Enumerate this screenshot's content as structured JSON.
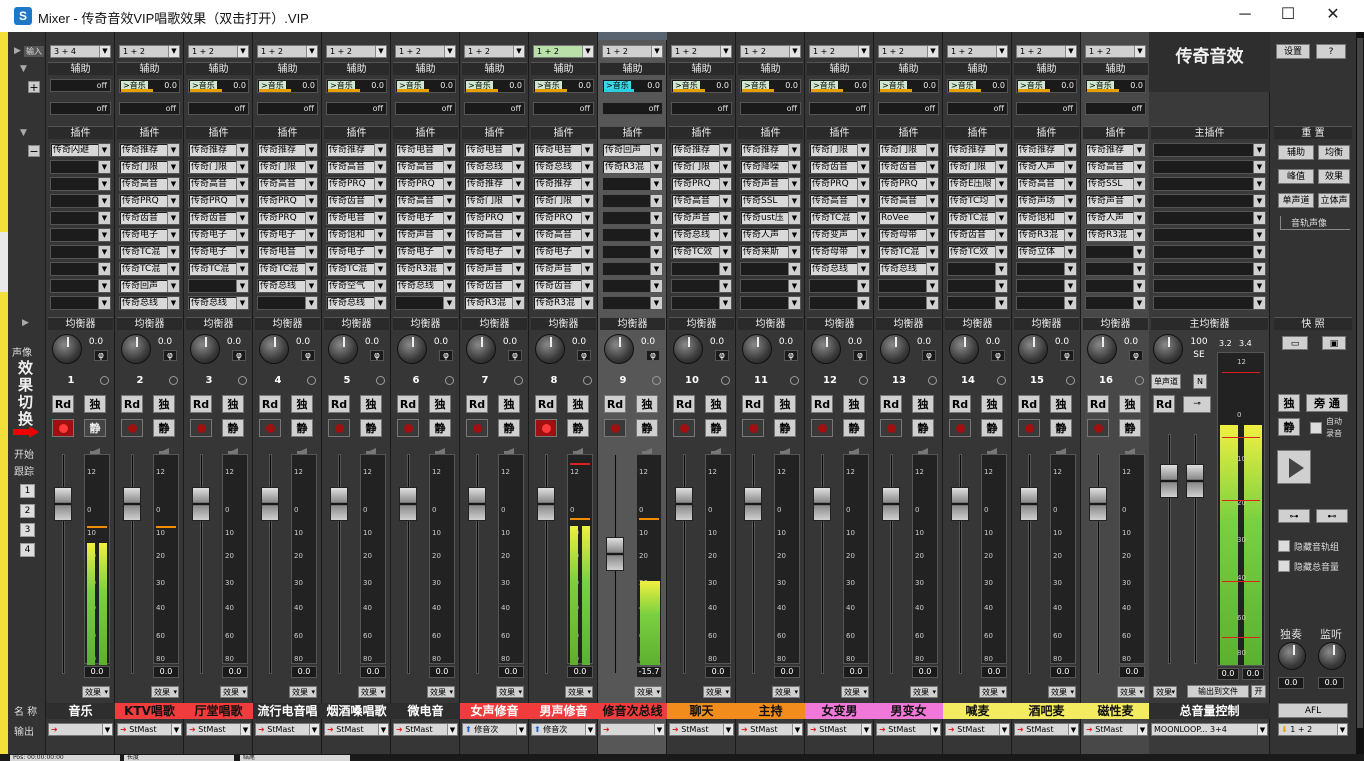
{
  "window": {
    "title": "Mixer - 传奇音效VIP唱歌效果（双击打开）.VIP",
    "min": "─",
    "max": "☐",
    "close": "✕"
  },
  "ctrl": {
    "input_label": "输入",
    "pan_label": "声像",
    "fx_switch": "效果切换",
    "start": "开始",
    "follow": "跟踪",
    "scenes": [
      "1",
      "2",
      "3",
      "4"
    ],
    "name_label": "名 称",
    "output_label": "输出"
  },
  "labels": {
    "aux": "辅助",
    "plugin": "插件",
    "eq": "均衡器",
    "off": "off",
    "fx": "效果",
    "rd": "Rd",
    "solo": "独",
    "mute": "静",
    "pan_unit": "φ"
  },
  "channels": [
    {
      "num": "1",
      "input": "3 + 4",
      "aux": "",
      "aux_val": "",
      "pan": "0.0",
      "db": "0.0",
      "name": "音乐",
      "name_bg": "#2e2e2e",
      "name_color": "#ffffff",
      "output": "",
      "plugins": [
        "传奇闪避",
        "",
        "",
        "",
        "",
        "",
        "",
        "",
        "",
        ""
      ],
      "meter": 0.58
    },
    {
      "num": "2",
      "input": "1 + 2",
      "aux": ">音乐",
      "aux_val": "0.0",
      "pan": "0.0",
      "db": "0.0",
      "name": "KTV唱歌",
      "name_bg": "#f03c3c",
      "name_color": "#111111",
      "output": "StMast",
      "plugins": [
        "传奇推荐",
        "传奇门限",
        "传奇高音",
        "传奇PRQ",
        "传奇齿音",
        "传奇电子",
        "传奇TC混",
        "传奇TC混",
        "传奇回声",
        "传奇总线"
      ],
      "meter": 0
    },
    {
      "num": "3",
      "input": "1 + 2",
      "aux": ">音乐",
      "aux_val": "0.0",
      "pan": "0.0",
      "db": "0.0",
      "name": "厅堂唱歌",
      "name_bg": "#f03c3c",
      "name_color": "#111111",
      "output": "StMast",
      "plugins": [
        "传奇推荐",
        "传奇门限",
        "传奇高音",
        "传奇PRQ",
        "传奇齿音",
        "传奇电子",
        "传奇电子",
        "传奇TC混",
        "",
        "传奇总线"
      ],
      "meter": 0
    },
    {
      "num": "4",
      "input": "1 + 2",
      "aux": ">音乐",
      "aux_val": "0.0",
      "pan": "0.0",
      "db": "0.0",
      "name": "流行电音唱",
      "name_bg": "#2e2e2e",
      "name_color": "#ffffff",
      "output": "StMast",
      "plugins": [
        "传奇推荐",
        "传奇门限",
        "传奇高音",
        "传奇PRQ",
        "传奇PRQ",
        "传奇电子",
        "传奇电音",
        "传奇TC混",
        "传奇总线",
        ""
      ],
      "meter": 0
    },
    {
      "num": "5",
      "input": "1 + 2",
      "aux": ">音乐",
      "aux_val": "0.0",
      "pan": "0.0",
      "db": "0.0",
      "name": "烟酒嗓唱歌",
      "name_bg": "#2e2e2e",
      "name_color": "#ffffff",
      "output": "StMast",
      "plugins": [
        "传奇推荐",
        "传奇高音",
        "传奇PRQ",
        "传奇齿音",
        "传奇电音",
        "传奇饱和",
        "传奇电子",
        "传奇TC混",
        "传奇空气",
        "传奇总线"
      ],
      "meter": 0
    },
    {
      "num": "6",
      "input": "1 + 2",
      "aux": ">音乐",
      "aux_val": "0.0",
      "pan": "0.0",
      "db": "0.0",
      "name": "微电音",
      "name_bg": "#2e2e2e",
      "name_color": "#ffffff",
      "output": "StMast",
      "plugins": [
        "传奇电音",
        "传奇高音",
        "传奇PRQ",
        "传奇高音",
        "传奇电子",
        "传奇声音",
        "传奇电子",
        "传奇R3混",
        "传奇总线",
        ""
      ],
      "meter": 0
    },
    {
      "num": "7",
      "input": "1 + 2",
      "aux": ">音乐",
      "aux_val": "0.0",
      "pan": "0.0",
      "db": "0.0",
      "name": "女声修音",
      "name_bg": "#f03c3c",
      "name_color": "#ffffff",
      "output": "修音次",
      "plugins": [
        "传奇电音",
        "传奇总线",
        "传奇推荐",
        "传奇门限",
        "传奇PRQ",
        "传奇高音",
        "传奇电子",
        "传奇声音",
        "传奇齿音",
        "传奇R3混"
      ],
      "meter": 0
    },
    {
      "num": "8",
      "input": "1 + 2",
      "aux": ">音乐",
      "aux_val": "0.0",
      "pan": "0.0",
      "db": "0.0",
      "name": "男声修音",
      "name_bg": "#f03c3c",
      "name_color": "#ffffff",
      "output": "修音次",
      "plugins": [
        "传奇电音",
        "传奇总线",
        "传奇推荐",
        "传奇门限",
        "传奇PRQ",
        "传奇高音",
        "传奇电子",
        "传奇声音",
        "传奇齿音",
        "传奇R3混"
      ],
      "meter": 0.66
    },
    {
      "num": "9",
      "input": "1 + 2",
      "aux": ">音乐",
      "aux_val": "0.0",
      "pan": "0.0",
      "db": "-15.7",
      "name": "修音次总线",
      "name_bg": "#f03c3c",
      "name_color": "#111111",
      "output": "",
      "plugins": [
        "传奇回声",
        "传奇R3混",
        "",
        "",
        "",
        "",
        "",
        "",
        "",
        ""
      ],
      "meter": 0.4
    },
    {
      "num": "10",
      "input": "1 + 2",
      "aux": ">音乐",
      "aux_val": "0.0",
      "pan": "0.0",
      "db": "0.0",
      "name": "聊天",
      "name_bg": "#f28c1c",
      "name_color": "#111111",
      "output": "StMast",
      "plugins": [
        "传奇推荐",
        "传奇门限",
        "传奇PRQ",
        "传奇高音",
        "传奇声音",
        "传奇总线",
        "传奇TC效",
        "",
        "",
        ""
      ],
      "meter": 0
    },
    {
      "num": "11",
      "input": "1 + 2",
      "aux": ">音乐",
      "aux_val": "0.0",
      "pan": "0.0",
      "db": "0.0",
      "name": "主持",
      "name_bg": "#f28c1c",
      "name_color": "#111111",
      "output": "StMast",
      "plugins": [
        "传奇推荐",
        "传奇降噪",
        "传奇声音",
        "传奇SSL",
        "传奇ust压",
        "传奇人声",
        "传奇莱斯",
        "",
        "",
        ""
      ],
      "meter": 0
    },
    {
      "num": "12",
      "input": "1 + 2",
      "aux": ">音乐",
      "aux_val": "0.0",
      "pan": "0.0",
      "db": "0.0",
      "name": "女变男",
      "name_bg": "#f078d8",
      "name_color": "#111111",
      "output": "StMast",
      "plugins": [
        "传奇门限",
        "传奇齿音",
        "传奇PRQ",
        "传奇高音",
        "传奇TC混",
        "传奇变声",
        "传奇母带",
        "传奇总线",
        "",
        ""
      ],
      "meter": 0
    },
    {
      "num": "13",
      "input": "1 + 2",
      "aux": ">音乐",
      "aux_val": "0.0",
      "pan": "0.0",
      "db": "0.0",
      "name": "男变女",
      "name_bg": "#f078d8",
      "name_color": "#111111",
      "output": "StMast",
      "plugins": [
        "传奇门限",
        "传奇齿音",
        "传奇PRQ",
        "传奇高音",
        "RoVee",
        "传奇母带",
        "传奇TC混",
        "传奇总线",
        "",
        ""
      ],
      "meter": 0
    },
    {
      "num": "14",
      "input": "1 + 2",
      "aux": ">音乐",
      "aux_val": "0.0",
      "pan": "0.0",
      "db": "0.0",
      "name": "喊麦",
      "name_bg": "#f4ec60",
      "name_color": "#111111",
      "output": "StMast",
      "plugins": [
        "传奇推荐",
        "传奇门限",
        "传奇E压限",
        "传奇TC均",
        "传奇TC混",
        "传奇齿音",
        "传奇TC效",
        "",
        "",
        ""
      ],
      "meter": 0
    },
    {
      "num": "15",
      "input": "1 + 2",
      "aux": ">音乐",
      "aux_val": "0.0",
      "pan": "0.0",
      "db": "0.0",
      "name": "酒吧麦",
      "name_bg": "#f4ec60",
      "name_color": "#111111",
      "output": "StMast",
      "plugins": [
        "传奇推荐",
        "传奇人声",
        "传奇高音",
        "传奇声场",
        "传奇饱和",
        "传奇R3混",
        "传奇立体",
        "",
        "",
        ""
      ],
      "meter": 0
    },
    {
      "num": "16",
      "input": "1 + 2",
      "aux": ">音乐",
      "aux_val": "0.0",
      "pan": "0.0",
      "db": "0.0",
      "name": "磁性麦",
      "name_bg": "#f4ec60",
      "name_color": "#111111",
      "output": "StMast",
      "plugins": [
        "传奇推荐",
        "传奇高音",
        "传奇SSL",
        "传奇声音",
        "传奇人声",
        "传奇R3混",
        "",
        "",
        "",
        ""
      ],
      "meter": 0
    }
  ],
  "master": {
    "logo": "传奇音效",
    "plugin_label": "主插件",
    "eq_label": "主均衡器",
    "pan": "100",
    "pan_unit": "SE",
    "mono_label": "单声道",
    "n_label": "N",
    "peak_l": "3.2",
    "peak_r": "3.4",
    "db_l": "0.0",
    "db_r": "0.0",
    "fx": "效果",
    "export": "输出到文件",
    "open": "开",
    "name": "总音量控制",
    "output": "MOONLOOP... 3+4",
    "meter_l": 0.77,
    "meter_r": 0.77
  },
  "right": {
    "settings": "设置",
    "help": "?",
    "reset": "重 置",
    "aux": "辅助",
    "eq": "均衡",
    "peak": "峰值",
    "fx": "效果",
    "mono": "单声道",
    "stereo": "立体声",
    "track_pan": "音轨声像",
    "snapshot": "快 照",
    "solo": "独",
    "bypass": "旁 通",
    "mute": "静",
    "auto_rec": "自动录音",
    "hide_tracks": "隐藏音轨组",
    "hide_master": "隐藏总音量",
    "solo_knob": "独奏",
    "monitor_knob": "监听",
    "solo_val": "0.0",
    "monitor_val": "0.0",
    "afl": "AFL",
    "out": "1 + 2"
  },
  "scale": [
    "12",
    "0",
    "10",
    "20",
    "30",
    "40",
    "60",
    "80"
  ],
  "statusbar": {
    "a": "Pos: 00:00:00:00",
    "b": "长度",
    "c": "结尾"
  }
}
